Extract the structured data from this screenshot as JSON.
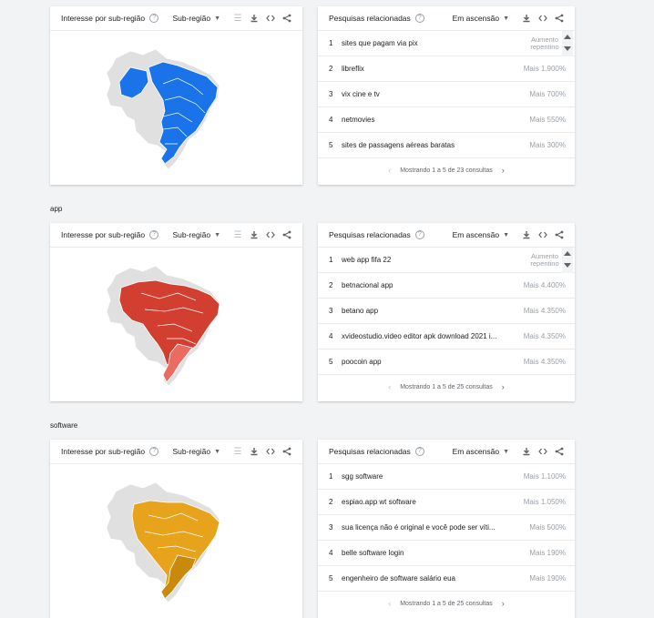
{
  "common": {
    "map_title": "Interesse por sub-região",
    "map_dropdown": "Sub-região",
    "related_title": "Pesquisas relacionadas",
    "related_dropdown": "Em ascensão",
    "help": "?"
  },
  "sections": [
    {
      "label": "",
      "map_color": "#1a73e8",
      "rows": [
        {
          "index": "1",
          "query": "sites que pagam via pix",
          "value": "Aumento repentino"
        },
        {
          "index": "2",
          "query": "libreflix",
          "value": "Mais 1.900%"
        },
        {
          "index": "3",
          "query": "vix cine e tv",
          "value": "Mais 700%"
        },
        {
          "index": "4",
          "query": "netmovies",
          "value": "Mais 550%"
        },
        {
          "index": "5",
          "query": "sites de passagens aéreas baratas",
          "value": "Mais 300%"
        }
      ],
      "pager": "Mostrando 1 a 5 de 23 consultas"
    },
    {
      "label": "app",
      "map_color": "#d23f31",
      "rows": [
        {
          "index": "1",
          "query": "web app fifa 22",
          "value": "Aumento repentino"
        },
        {
          "index": "2",
          "query": "betnacional app",
          "value": "Mais 4.400%"
        },
        {
          "index": "3",
          "query": "betano app",
          "value": "Mais 4.350%"
        },
        {
          "index": "4",
          "query": "xvideostudio.video editor apk download 2021 i...",
          "value": "Mais 4.350%"
        },
        {
          "index": "5",
          "query": "poocoin app",
          "value": "Mais 4.350%"
        }
      ],
      "pager": "Mostrando 1 a 5 de 25 consultas"
    },
    {
      "label": "software",
      "map_color": "#e6a31b",
      "rows": [
        {
          "index": "1",
          "query": "sgg software",
          "value": "Mais 1.100%"
        },
        {
          "index": "2",
          "query": "espiao.app wt software",
          "value": "Mais 1.050%"
        },
        {
          "index": "3",
          "query": "sua licença não é original e você pode ser víti...",
          "value": "Mais 500%"
        },
        {
          "index": "4",
          "query": "belle software login",
          "value": "Mais 190%"
        },
        {
          "index": "5",
          "query": "engenheiro de software salário eua",
          "value": "Mais 190%"
        }
      ],
      "pager": "Mostrando 1 a 5 de 25 consultas"
    }
  ]
}
